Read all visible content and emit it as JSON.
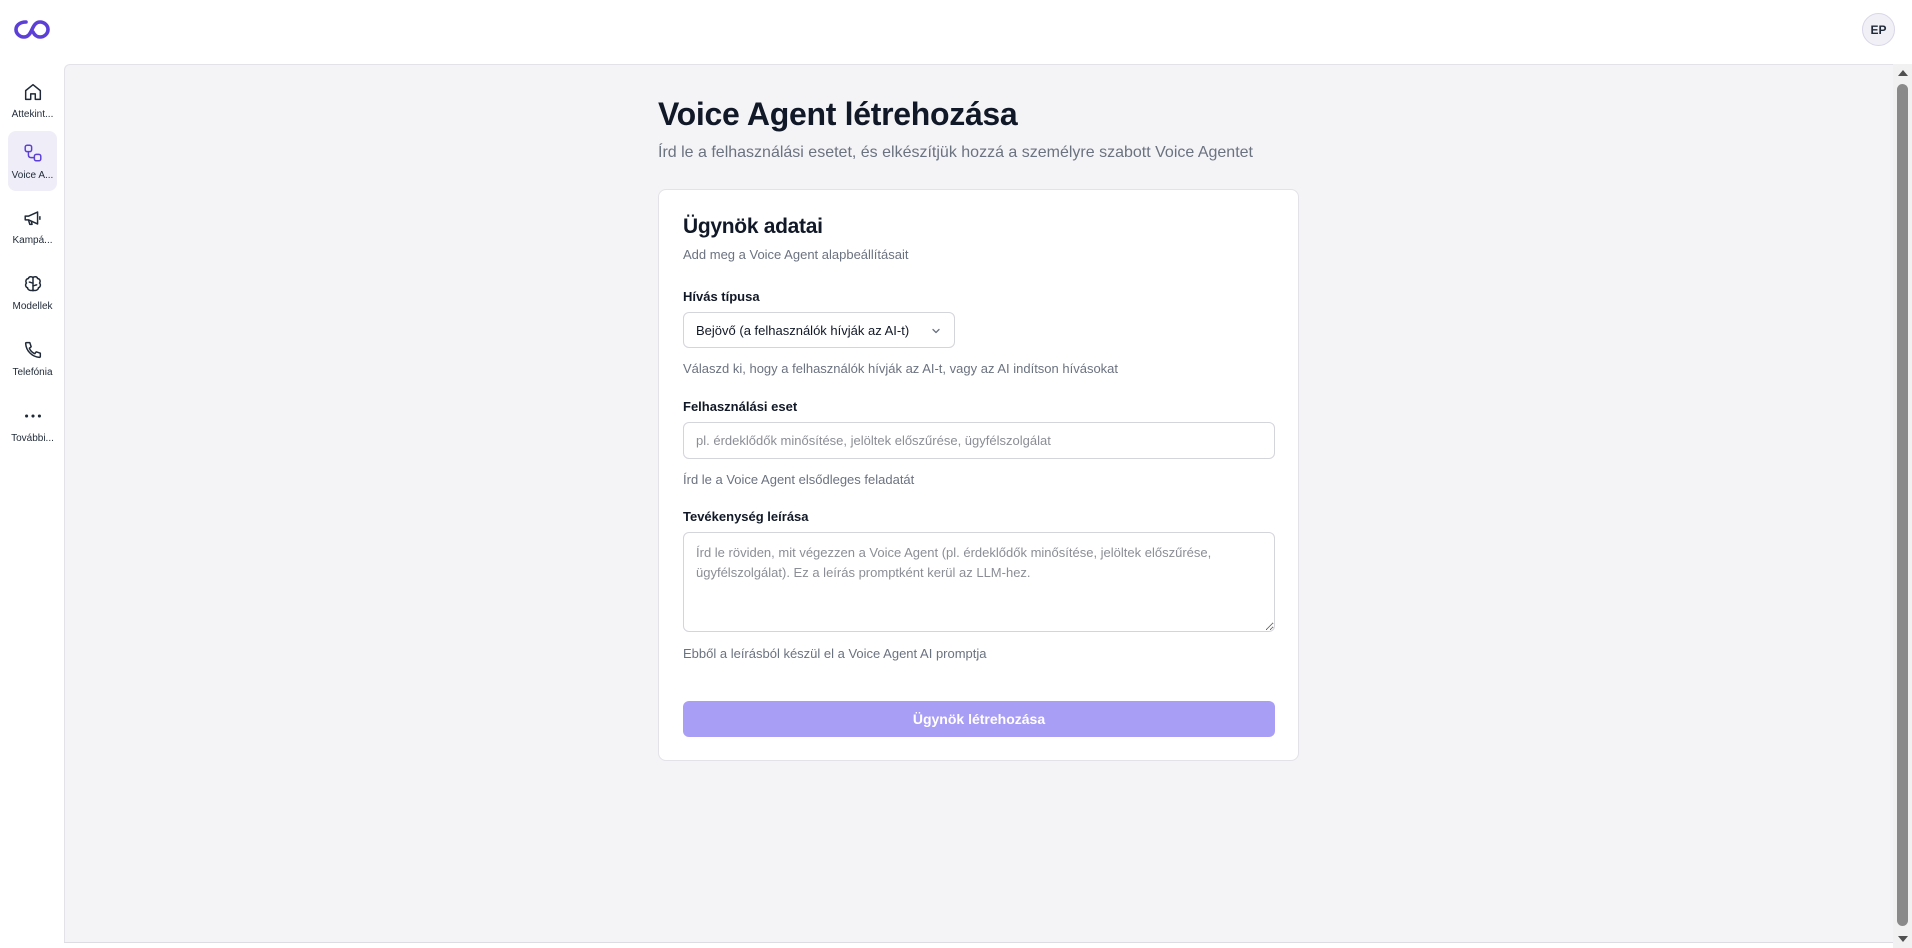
{
  "header": {
    "logo_icon": "infinity-logo-icon",
    "avatar_initials": "EP",
    "accent_color": "#5b3fd6"
  },
  "sidebar": {
    "items": [
      {
        "id": "overview",
        "label": "Áttekint...",
        "icon": "home-icon",
        "active": false
      },
      {
        "id": "voice-agents",
        "label": "Voice A...",
        "icon": "nodes-icon",
        "active": true
      },
      {
        "id": "campaigns",
        "label": "Kampá...",
        "icon": "megaphone-icon",
        "active": false
      },
      {
        "id": "models",
        "label": "Modellek",
        "icon": "brain-icon",
        "active": false
      },
      {
        "id": "telephony",
        "label": "Telefónia",
        "icon": "phone-icon",
        "active": false
      },
      {
        "id": "more",
        "label": "További...",
        "icon": "more-dots-icon",
        "active": false
      }
    ]
  },
  "page": {
    "title": "Voice Agent létrehozása",
    "subtitle": "Írd le a felhasználási esetet, és elkészítjük hozzá a személyre szabott Voice Agentet"
  },
  "card": {
    "title": "Ügynök adatai",
    "subtitle": "Add meg a Voice Agent alapbeállításait",
    "call_type": {
      "label": "Hívás típusa",
      "value": "Bejövő (a felhasználók hívják az AI-t)",
      "help": "Válaszd ki, hogy a felhasználók hívják az AI-t, vagy az AI indítson hívásokat"
    },
    "use_case": {
      "label": "Felhasználási eset",
      "value": "",
      "placeholder": "pl. érdeklődők minősítése, jelöltek előszűrése, ügyfélszolgálat",
      "help": "Írd le a Voice Agent elsődleges feladatát"
    },
    "activity": {
      "label": "Tevékenység leírása",
      "value": "",
      "placeholder": "Írd le röviden, mit végezzen a Voice Agent (pl. érdeklődők minősítése, jelöltek előszűrése, ügyfélszolgálat). Ez a leírás promptként kerül az LLM-hez.",
      "help": "Ebből a leírásból készül el a Voice Agent AI promptja"
    },
    "submit_label": "Ügynök létrehozása",
    "submit_color": "#a99ef5"
  }
}
